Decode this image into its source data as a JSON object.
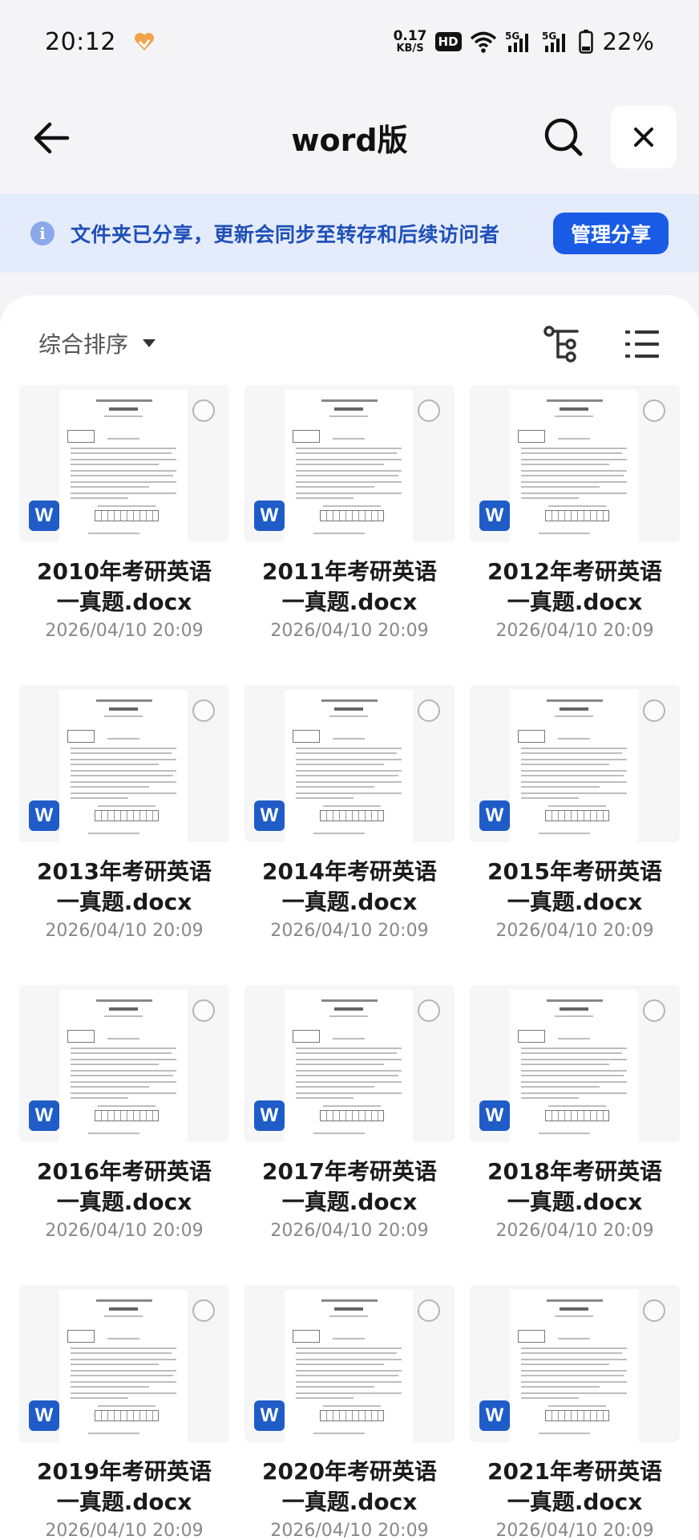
{
  "status_bar": {
    "time": "20:12",
    "net_speed_value": "0.17",
    "net_speed_unit": "KB/S",
    "hd_badge": "HD",
    "battery": "22%",
    "icons": [
      "app-heart-icon",
      "wifi-icon",
      "signal-5g-icon",
      "signal-5g-icon",
      "battery-icon"
    ]
  },
  "header": {
    "title": "word版",
    "back_icon": "arrow-left-icon",
    "search_icon": "search-icon",
    "close_icon": "close-icon"
  },
  "share_banner": {
    "text": "文件夹已分享，更新会同步至转存和后续访问者",
    "button_label": "管理分享",
    "info_icon_glyph": "i"
  },
  "toolbar": {
    "sort_label": "综合排序",
    "tree_icon": "tree-view-icon",
    "list_icon": "list-view-icon"
  },
  "colors": {
    "accent": "#1a5be6",
    "banner_bg": "#e4ebfa",
    "banner_text": "#1f50b8",
    "word_blue": "#1f5cc8"
  },
  "files": [
    {
      "name_line1": "2010年考研英语",
      "name_line2": "一真题.docx",
      "date": "2026/04/10 20:09",
      "type_badge": "W"
    },
    {
      "name_line1": "2011年考研英语",
      "name_line2": "一真题.docx",
      "date": "2026/04/10 20:09",
      "type_badge": "W"
    },
    {
      "name_line1": "2012年考研英语",
      "name_line2": "一真题.docx",
      "date": "2026/04/10 20:09",
      "type_badge": "W"
    },
    {
      "name_line1": "2013年考研英语",
      "name_line2": "一真题.docx",
      "date": "2026/04/10 20:09",
      "type_badge": "W"
    },
    {
      "name_line1": "2014年考研英语",
      "name_line2": "一真题.docx",
      "date": "2026/04/10 20:09",
      "type_badge": "W"
    },
    {
      "name_line1": "2015年考研英语",
      "name_line2": "一真题.docx",
      "date": "2026/04/10 20:09",
      "type_badge": "W"
    },
    {
      "name_line1": "2016年考研英语",
      "name_line2": "一真题.docx",
      "date": "2026/04/10 20:09",
      "type_badge": "W"
    },
    {
      "name_line1": "2017年考研英语",
      "name_line2": "一真题.docx",
      "date": "2026/04/10 20:09",
      "type_badge": "W"
    },
    {
      "name_line1": "2018年考研英语",
      "name_line2": "一真题.docx",
      "date": "2026/04/10 20:09",
      "type_badge": "W"
    },
    {
      "name_line1": "2019年考研英语",
      "name_line2": "一真题.docx",
      "date": "2026/04/10 20:09",
      "type_badge": "W"
    },
    {
      "name_line1": "2020年考研英语",
      "name_line2": "一真题.docx",
      "date": "2026/04/10 20:09",
      "type_badge": "W"
    },
    {
      "name_line1": "2021年考研英语",
      "name_line2": "一真题.docx",
      "date": "2026/04/10 20:09",
      "type_badge": "W"
    }
  ]
}
